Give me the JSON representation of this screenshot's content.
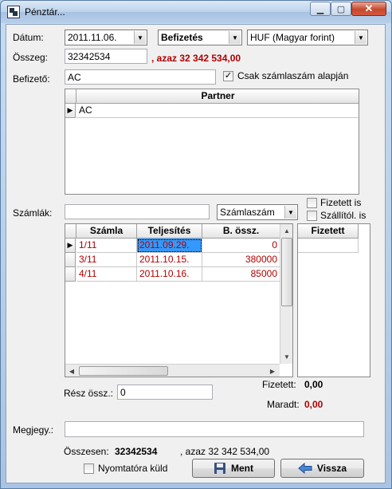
{
  "window": {
    "title": "Pénztár...",
    "minimize": "▁",
    "maximize": "▢",
    "close": "✕"
  },
  "form": {
    "datum_label": "Dátum:",
    "datum_value": "2011.11.06.",
    "type_value": "Befizetés",
    "currency_value": "HUF (Magyar forint)",
    "osszeg_label": "Összeg:",
    "osszeg_value": "32342534",
    "osszeg_words": ", azaz 32 342 534,00",
    "befizeto_label": "Befizető:",
    "befizeto_value": "AC",
    "csak_szamlaszam_label": "Csak számlaszám alapján",
    "csak_szamlaszam_checked": true
  },
  "partner_grid": {
    "header": "Partner",
    "rows": [
      "AC"
    ]
  },
  "invoices": {
    "label": "Számlák:",
    "search_value": "",
    "search_by": "Számlaszám",
    "fizetett_is_label": "Fizetett is",
    "szallitol_is_label": "Szállítól. is",
    "columns": [
      "Számla",
      "Teljesítés",
      "B. össz."
    ],
    "rows": [
      {
        "szamla": "1/11",
        "teljesites": "2011.09.29.",
        "bossz": "0"
      },
      {
        "szamla": "3/11",
        "teljesites": "2011.10.15.",
        "bossz": "380000"
      },
      {
        "szamla": "4/11",
        "teljesites": "2011.10.16.",
        "bossz": "85000"
      }
    ],
    "paid_column": "Fizetett"
  },
  "summary": {
    "resz_ossz_label": "Rész össz.:",
    "resz_ossz_value": "0",
    "fizetett_label": "Fizetett:",
    "fizetett_value": "0,00",
    "maradt_label": "Maradt:",
    "maradt_value": "0,00",
    "megjegy_label": "Megjegy.:",
    "megjegy_value": "",
    "osszesen_label": "Összesen:",
    "osszesen_value": "32342534",
    "osszesen_words": ", azaz 32 342 534,00",
    "nyomtatora_label": "Nyomtatóra küld"
  },
  "buttons": {
    "ment": "Ment",
    "vissza": "Vissza"
  },
  "colors": {
    "accent_red": "#b00000",
    "selection": "#3399ff"
  }
}
